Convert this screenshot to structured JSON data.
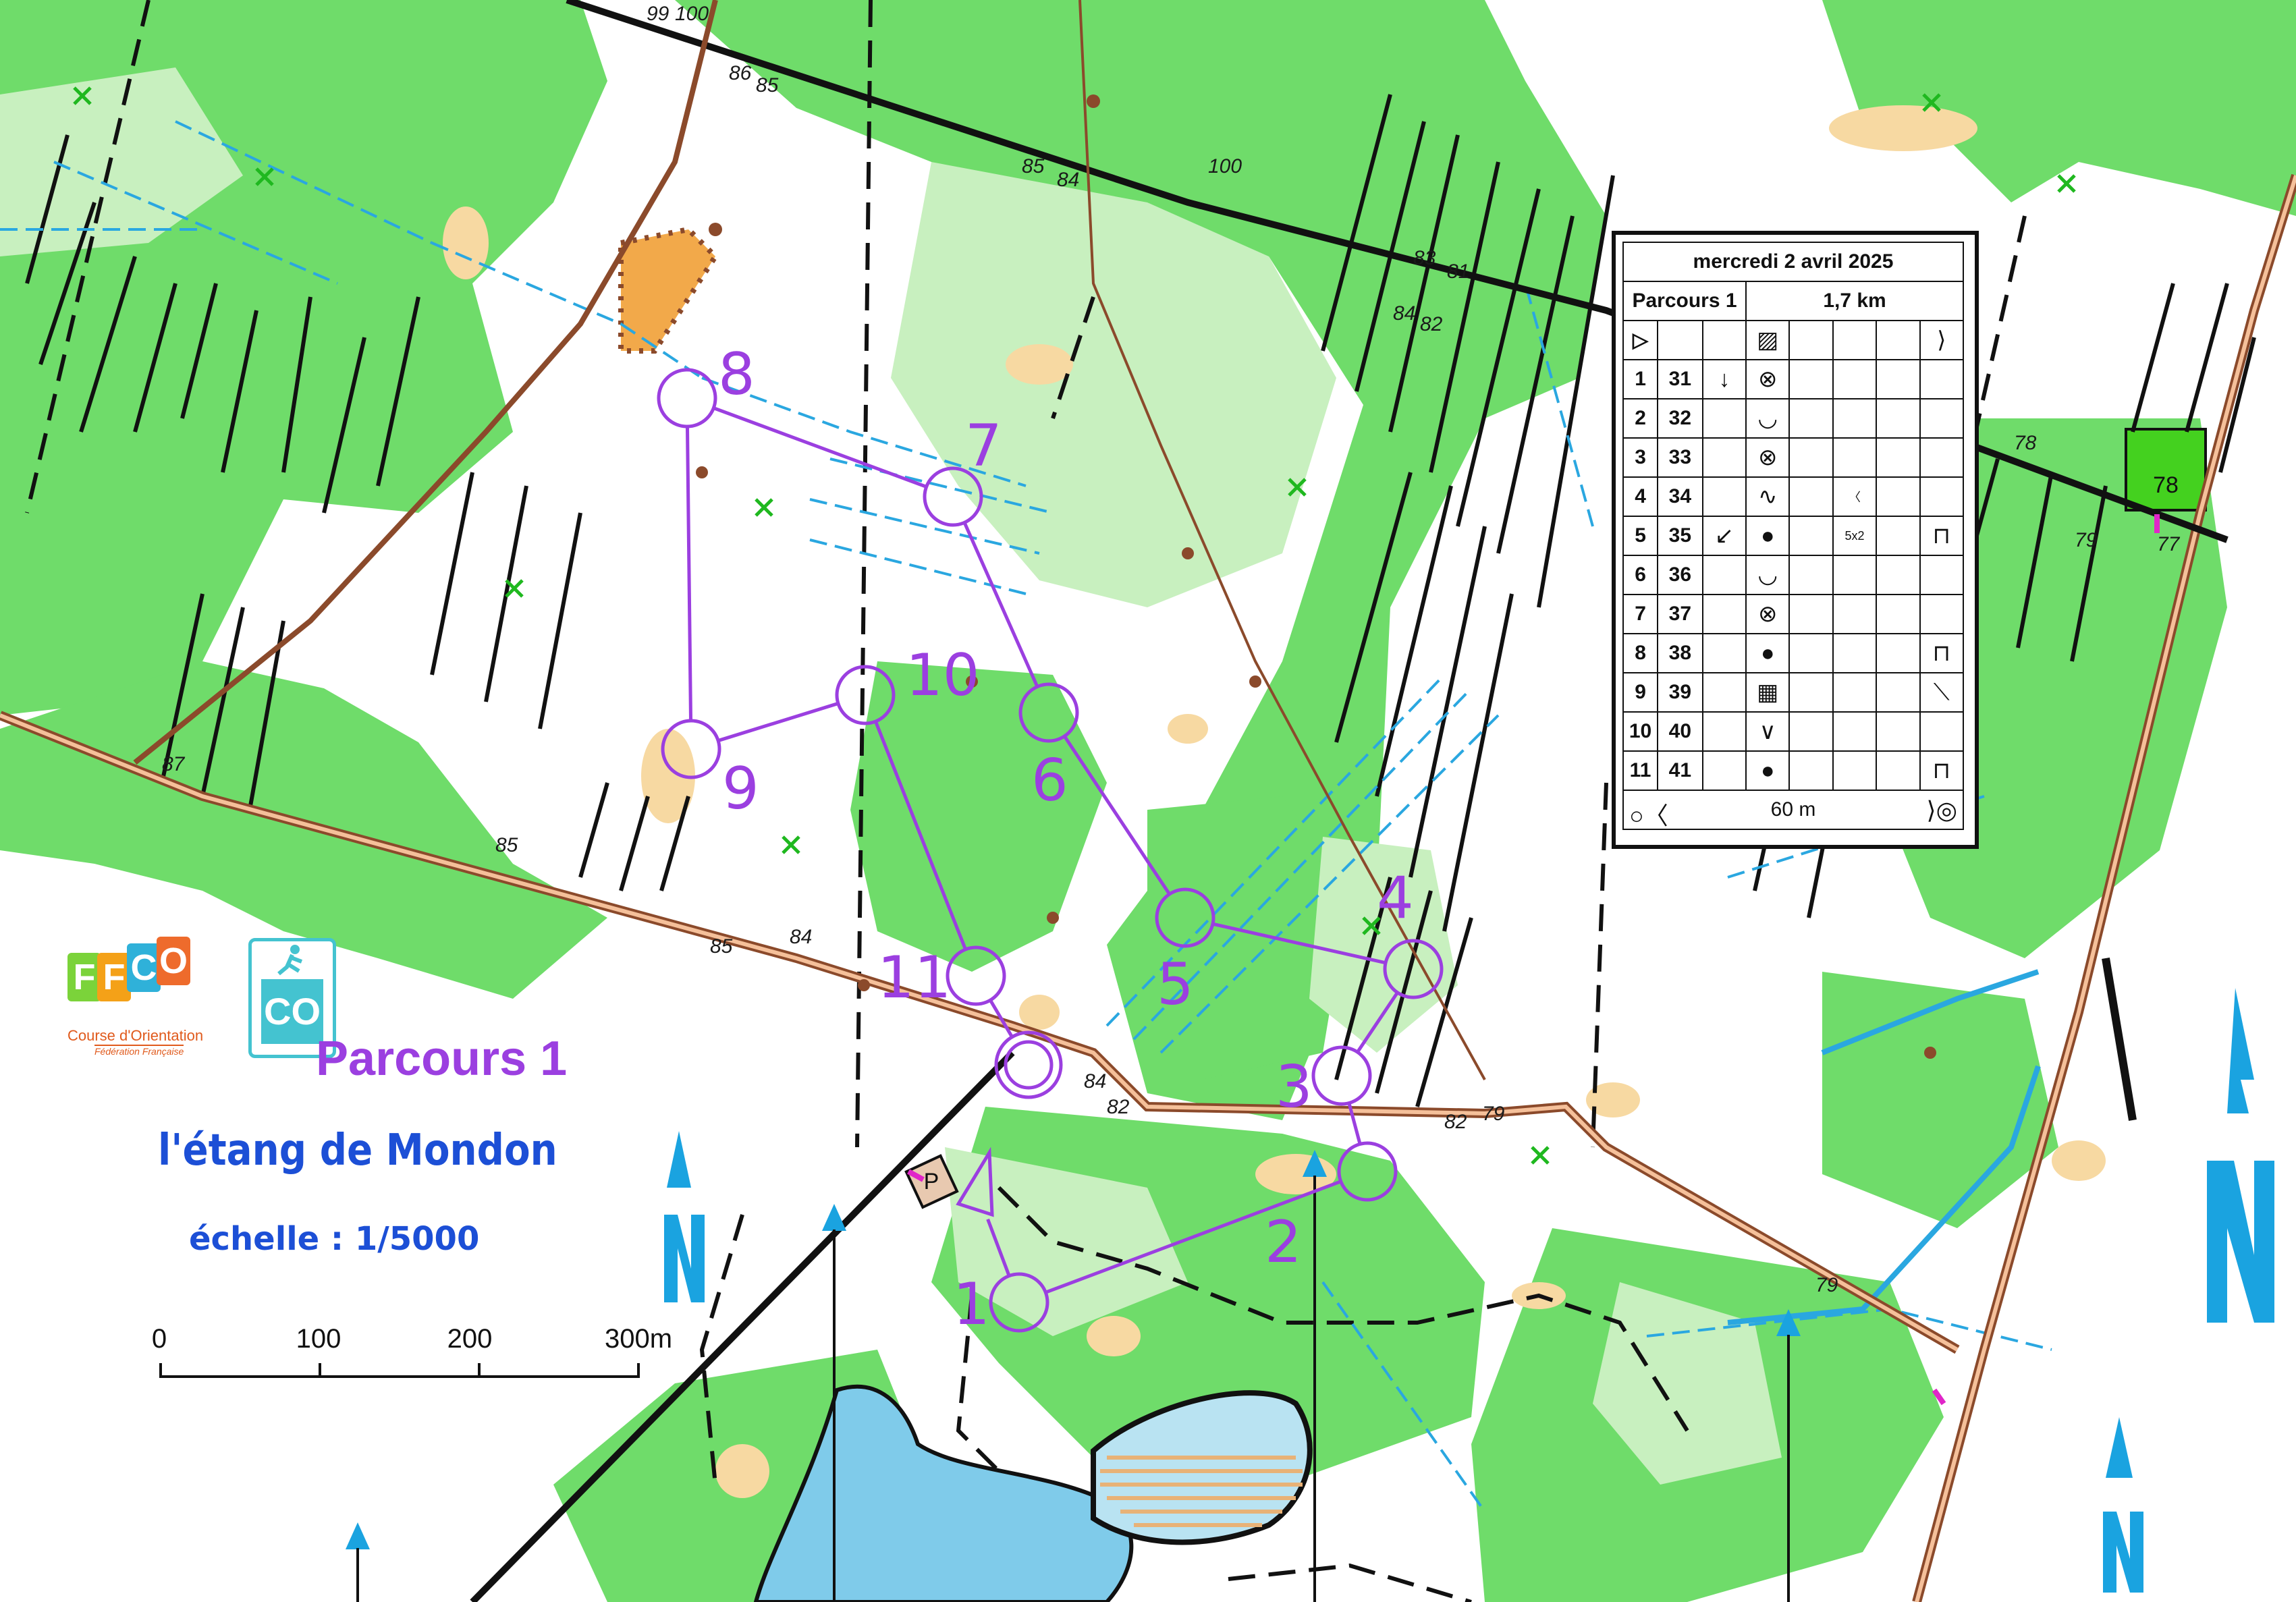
{
  "map": {
    "course_name": "Parcours 1",
    "place": "l'étang de Mondon",
    "scale_text": "échelle : 1/5000",
    "scale_bar_labels": [
      "0",
      "100",
      "200",
      "300m"
    ],
    "logos": {
      "ffco_letters": [
        "F",
        "F",
        "C",
        "O"
      ],
      "ffco_caption": "Course d'Orientation",
      "ffco_subcaption": "Fédération Française",
      "co_badge": "CO"
    },
    "control_numbers": [
      "1",
      "2",
      "3",
      "4",
      "5",
      "6",
      "7",
      "8",
      "9",
      "10",
      "11"
    ],
    "contour_labels": [
      "99",
      "100",
      "86",
      "85",
      "85",
      "84",
      "100",
      "83",
      "81",
      "84",
      "82",
      "78",
      "79",
      "77",
      "87",
      "85",
      "85",
      "84",
      "84",
      "82",
      "82",
      "79",
      "79"
    ],
    "field_box_label": "78",
    "legend": {
      "parking": "P"
    }
  },
  "description_sheet": {
    "date": "mercredi 2 avril 2025",
    "course": "Parcours 1",
    "length": "1,7 km",
    "start_symbol": "▷",
    "start_feature": "▨",
    "start_extra": "⟩",
    "controls": [
      {
        "n": "1",
        "code": "31",
        "dir": "↓",
        "feature": "⊗",
        "detail": "",
        "pos": ""
      },
      {
        "n": "2",
        "code": "32",
        "dir": "",
        "feature": "◡",
        "detail": "",
        "pos": ""
      },
      {
        "n": "3",
        "code": "33",
        "dir": "",
        "feature": "⊗",
        "detail": "",
        "pos": ""
      },
      {
        "n": "4",
        "code": "34",
        "dir": "",
        "feature": "∿",
        "detail": "〈",
        "pos": ""
      },
      {
        "n": "5",
        "code": "35",
        "dir": "↙",
        "feature": "●",
        "detail": "5x2",
        "pos": "⊓"
      },
      {
        "n": "6",
        "code": "36",
        "dir": "",
        "feature": "◡",
        "detail": "",
        "pos": ""
      },
      {
        "n": "7",
        "code": "37",
        "dir": "",
        "feature": "⊗",
        "detail": "",
        "pos": ""
      },
      {
        "n": "8",
        "code": "38",
        "dir": "",
        "feature": "●",
        "detail": "",
        "pos": "⊓"
      },
      {
        "n": "9",
        "code": "39",
        "dir": "",
        "feature": "▦",
        "detail": "",
        "pos": "⟍"
      },
      {
        "n": "10",
        "code": "40",
        "dir": "",
        "feature": "∨",
        "detail": "",
        "pos": ""
      },
      {
        "n": "11",
        "code": "41",
        "dir": "",
        "feature": "●",
        "detail": "",
        "pos": "⊓"
      }
    ],
    "finish_distance": "60 m",
    "finish_left": "○〈",
    "finish_right": "⟩◎"
  },
  "colors": {
    "course": "#9b3fe0",
    "forest_green": "#5fd65f",
    "light_green": "#c9f0c0",
    "open_yellow": "#f9d9a0",
    "water_blue": "#7fcbea",
    "road_brown": "#8b4a2b",
    "north_arrow": "#1aa3e0",
    "title_blue": "#1c4fd6"
  }
}
